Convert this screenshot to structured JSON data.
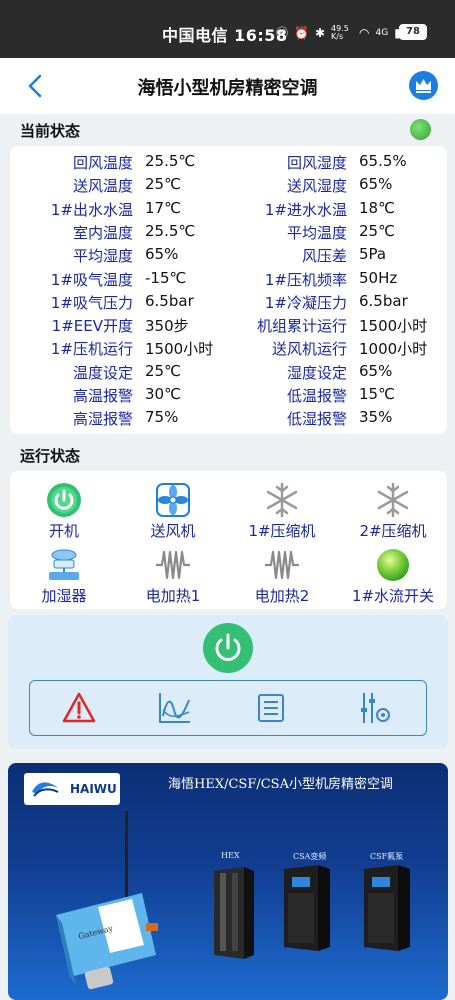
{
  "status_bar": {
    "text": "中国电信 16:58",
    "net_speed": "49.5 K/s",
    "network": "4G",
    "battery": "78"
  },
  "header": {
    "title": "海悟小型机房精密空调"
  },
  "current_status": {
    "title": "当前状态",
    "rows": [
      {
        "l1": "回风温度",
        "v1": "25.5℃",
        "l2": "回风湿度",
        "v2": "65.5%"
      },
      {
        "l1": "送风温度",
        "v1": "25℃",
        "l2": "送风湿度",
        "v2": "65%"
      },
      {
        "l1": "1#出水水温",
        "v1": "17℃",
        "l2": "1#进水水温",
        "v2": "18℃"
      },
      {
        "l1": "室内温度",
        "v1": "25.5℃",
        "l2": "平均温度",
        "v2": "25℃"
      },
      {
        "l1": "平均湿度",
        "v1": "65%",
        "l2": "风压差",
        "v2": "5Pa"
      },
      {
        "l1": "1#吸气温度",
        "v1": "-15℃",
        "l2": "1#压机频率",
        "v2": "50Hz"
      },
      {
        "l1": "1#吸气压力",
        "v1": "6.5bar",
        "l2": "1#冷凝压力",
        "v2": "6.5bar"
      },
      {
        "l1": "1#EEV开度",
        "v1": "350步",
        "l2": "机组累计运行",
        "v2": "1500小时"
      },
      {
        "l1": "1#压机运行",
        "v1": "1500小时",
        "l2": "送风机运行",
        "v2": "1000小时"
      },
      {
        "l1": "温度设定",
        "v1": "25℃",
        "l2": "湿度设定",
        "v2": "65%"
      },
      {
        "l1": "高温报警",
        "v1": "30℃",
        "l2": "低温报警",
        "v2": "15℃"
      },
      {
        "l1": "高湿报警",
        "v1": "75%",
        "l2": "低湿报警",
        "v2": "35%"
      }
    ]
  },
  "run_status": {
    "title": "运行状态",
    "devices": [
      {
        "label": "开机",
        "icon": "power-on-icon",
        "active": true
      },
      {
        "label": "送风机",
        "icon": "fan-icon",
        "active": true
      },
      {
        "label": "1#压缩机",
        "icon": "snowflake-icon",
        "active": false
      },
      {
        "label": "2#压缩机",
        "icon": "snowflake-icon",
        "active": false
      },
      {
        "label": "加湿器",
        "icon": "humidifier-icon",
        "active": true
      },
      {
        "label": "电加热1",
        "icon": "heater-icon",
        "active": false
      },
      {
        "label": "电加热2",
        "icon": "heater-icon",
        "active": false
      },
      {
        "label": "1#水流开关",
        "icon": "green-ball-icon",
        "active": true
      }
    ]
  },
  "toolbar": {
    "items": [
      "alarm-icon",
      "chart-icon",
      "list-icon",
      "settings-sliders-icon"
    ]
  },
  "banner": {
    "brand": "HAIWU",
    "title": "海悟HEX/CSF/CSA小型机房精密空调",
    "units": [
      "HEX",
      "CSA变频",
      "CSF氟泵"
    ],
    "gateway_label": "Gateway"
  },
  "colors": {
    "label_blue": "#1a28a8",
    "accent_blue": "#1a7fe0",
    "status_green": "#33c074",
    "panel_bg": "#dcecf9"
  }
}
